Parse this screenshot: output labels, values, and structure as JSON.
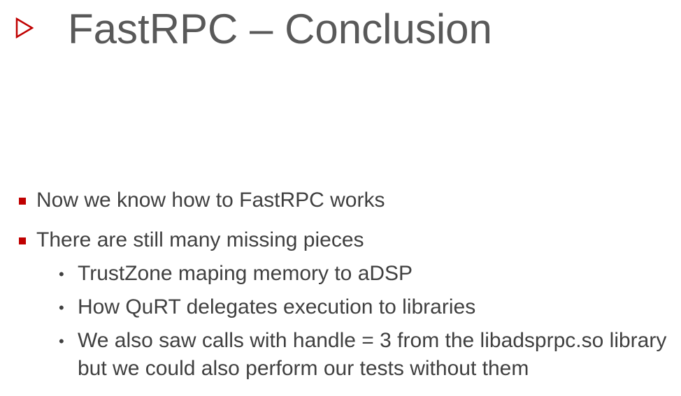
{
  "slide": {
    "title": "FastRPC – Conclusion",
    "accent_color": "#c00000",
    "title_icon": "triangle-right-outline-icon",
    "bullets": [
      {
        "text": "Now we know how to FastRPC works",
        "children": []
      },
      {
        "text": "There are still many missing pieces",
        "children": [
          "TrustZone maping memory to aDSP",
          "How QuRT delegates execution to libraries",
          "We also saw calls with handle = 3 from the libadsprpc.so library but we could also perform our tests without them"
        ]
      }
    ]
  }
}
